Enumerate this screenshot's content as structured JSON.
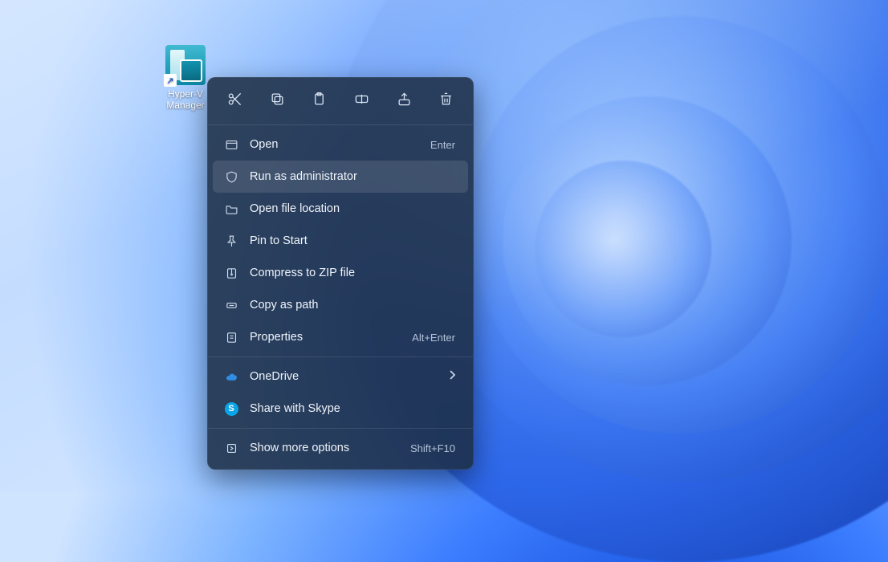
{
  "desktop": {
    "icon_label": "Hyper-V Manager",
    "shortcut_arrow": "↗"
  },
  "context_menu": {
    "quick_actions": [
      {
        "name": "cut"
      },
      {
        "name": "copy"
      },
      {
        "name": "paste"
      },
      {
        "name": "rename"
      },
      {
        "name": "share"
      },
      {
        "name": "delete"
      }
    ],
    "items_primary": [
      {
        "icon": "app-window",
        "label": "Open",
        "accel": "Enter"
      },
      {
        "icon": "shield",
        "label": "Run as administrator",
        "hovered": true
      },
      {
        "icon": "folder",
        "label": "Open file location"
      },
      {
        "icon": "pin",
        "label": "Pin to Start"
      },
      {
        "icon": "zip",
        "label": "Compress to ZIP file"
      },
      {
        "icon": "path",
        "label": "Copy as path"
      },
      {
        "icon": "properties",
        "label": "Properties",
        "accel": "Alt+Enter"
      }
    ],
    "items_secondary": [
      {
        "icon": "onedrive",
        "label": "OneDrive",
        "chevron": true
      },
      {
        "icon": "skype",
        "label": "Share with Skype"
      }
    ],
    "items_tertiary": [
      {
        "icon": "more",
        "label": "Show more options",
        "accel": "Shift+F10"
      }
    ]
  }
}
